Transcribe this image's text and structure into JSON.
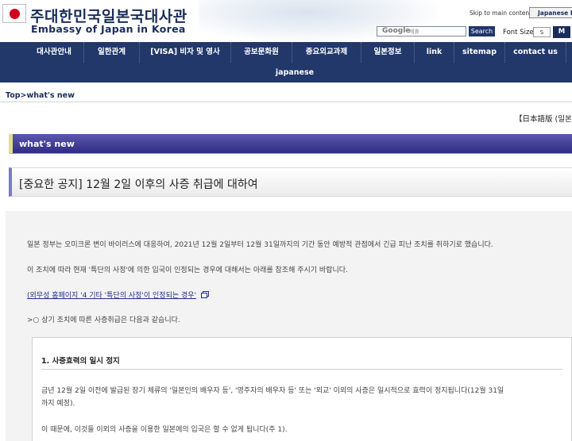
{
  "header": {
    "logo_kr": "주대한민국일본국대사관",
    "logo_en": "Embassy of Japan in Korea",
    "skip_link": "Skip to main content",
    "japanese_home": "Japanese Ho",
    "search_logo": "Google",
    "search_placeholder": "제휴",
    "search_button": "Search",
    "font_size_label": "Font Size",
    "font_small": "S",
    "font_medium": "M"
  },
  "nav": {
    "items": [
      "대사관안내",
      "일한관계",
      "[VISA] 비자 및 영사",
      "공보문화원",
      "중요외교과제",
      "일본정보",
      "link",
      "sitemap",
      "contact us",
      "japanese"
    ]
  },
  "breadcrumb": "Top>what's new",
  "jp_version": "【日本語版 (일본어",
  "section_title": "what's new",
  "page_title": "[중요한 공지] 12월 2일 이후의 사증 취급에 대하여",
  "body": {
    "p1": "일본 정부는 오미크론 변이 바이러스에 대응하여, 2021년 12월 2일부터 12월 31일까지의 기간 동안 예방적 관점에서 긴급 피난 조치를 취하기로 했습니다.",
    "p2": "이 조치에 따라 현재 '특단의 사정'에 의한 입국이 인정되는 경우에 대해서는 아래를 참조해 주시기 바랍니다.",
    "link": "(외무성 홈페이지 '4 기타 '특단의 사정'이 인정되는 경우'",
    "p3": ">○ 상기 조치에 따른 사증취급은 다음과 같습니다.",
    "box_heading": "1. 사증효력의 일시 정지",
    "box_p1_line1": "금년 12월 2일 이전에 발급된 장기 체류의 '일본인의 배우자 등', '영주자의 배우자 등' 또는 '외교' 이외의 사증은 일시적으로 효력이 정지됩니다(12월 31일",
    "box_p1_line2": "까지 예정).",
    "box_p2": "이 때문에, 이것들 이외의 사증을 이용한 일본에의 입국은 할 수 없게 됩니다(주 1)."
  },
  "colors": {
    "nav_bg": "#22386b",
    "section_bar": "#3f3c98",
    "accent_yellow": "#e0de86",
    "flag_red": "#d0021b"
  }
}
